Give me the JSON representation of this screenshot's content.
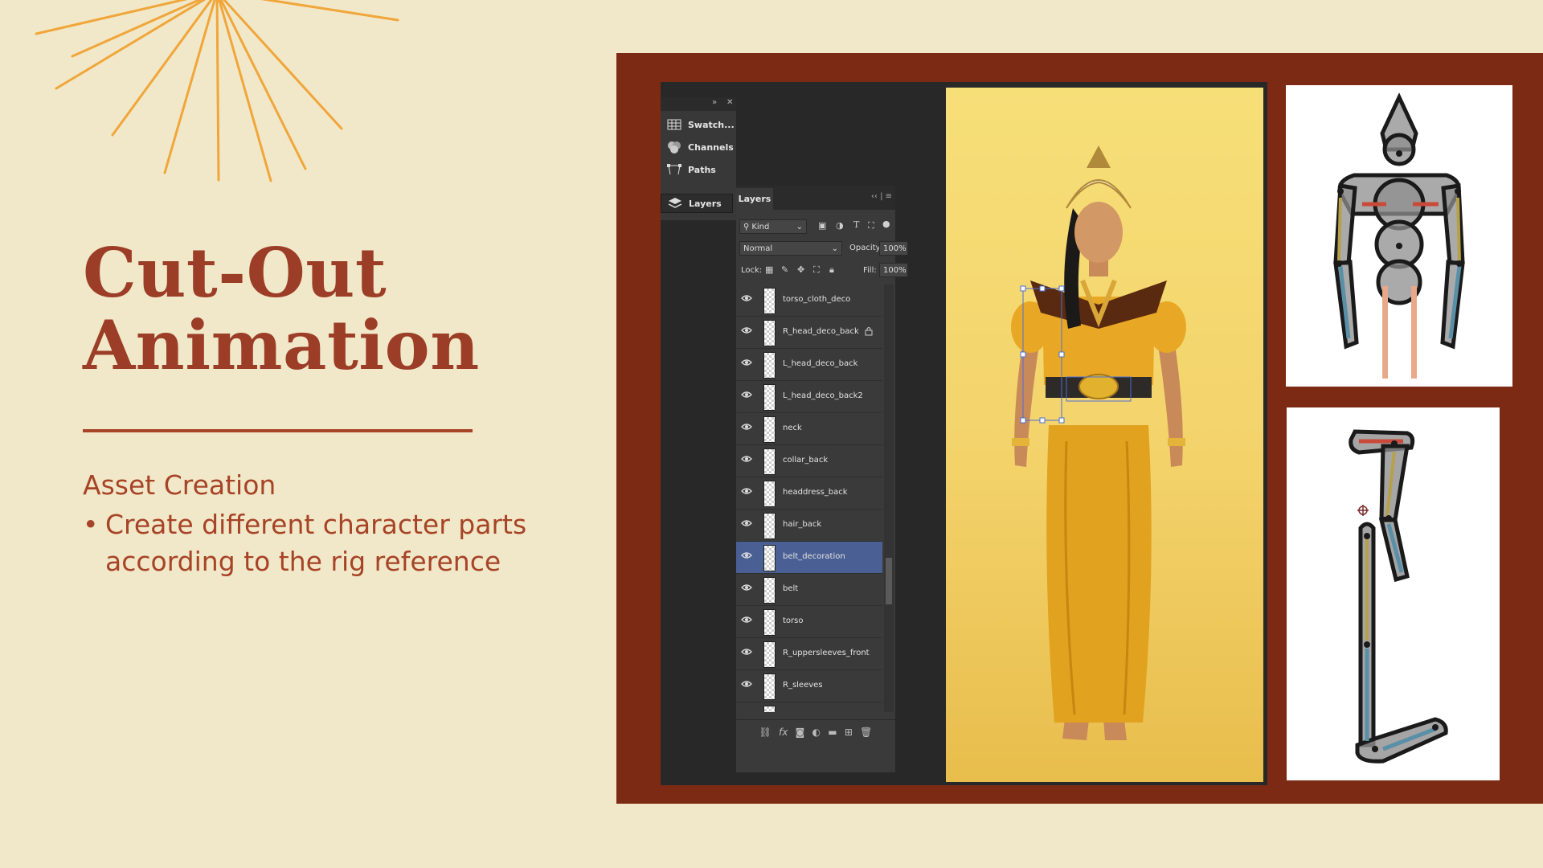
{
  "slide": {
    "title_line1": "Cut-Out",
    "title_line2": "Animation",
    "subtitle": "Asset Creation",
    "bullet": "Create different character parts according to the rig reference",
    "colors": {
      "background": "#f1e8c9",
      "accent": "#a74326",
      "frame": "#7d2a14",
      "sunburst": "#f0a63a"
    }
  },
  "photoshop": {
    "dock": {
      "items": [
        {
          "label": "Swatch...",
          "icon": "swatches-icon"
        },
        {
          "label": "Channels",
          "icon": "channels-icon"
        },
        {
          "label": "Paths",
          "icon": "paths-icon"
        },
        {
          "label": "Layers",
          "icon": "layers-icon"
        }
      ]
    },
    "layers_panel": {
      "tab": "Layers",
      "filter_kind": "Kind",
      "blend_mode": "Normal",
      "opacity_label": "Opacity:",
      "opacity_value": "100%",
      "lock_label": "Lock:",
      "fill_label": "Fill:",
      "fill_value": "100%",
      "layers": [
        {
          "name": "torso_cloth_deco",
          "selected": false,
          "locked": false
        },
        {
          "name": "R_head_deco_back",
          "selected": false,
          "locked": true
        },
        {
          "name": "L_head_deco_back",
          "selected": false,
          "locked": false
        },
        {
          "name": "L_head_deco_back2",
          "selected": false,
          "locked": false
        },
        {
          "name": "neck",
          "selected": false,
          "locked": false
        },
        {
          "name": "collar_back",
          "selected": false,
          "locked": false
        },
        {
          "name": "headdress_back",
          "selected": false,
          "locked": false
        },
        {
          "name": "hair_back",
          "selected": false,
          "locked": false
        },
        {
          "name": "belt_decoration",
          "selected": true,
          "locked": false
        },
        {
          "name": "belt",
          "selected": false,
          "locked": false
        },
        {
          "name": "torso",
          "selected": false,
          "locked": false
        },
        {
          "name": "R_uppersleeves_front",
          "selected": false,
          "locked": false
        },
        {
          "name": "R_sleeves",
          "selected": false,
          "locked": false
        },
        {
          "name": "",
          "selected": false,
          "locked": false
        }
      ],
      "footer_icons": [
        "link-icon",
        "fx-icon",
        "mask-icon",
        "adjustment-icon",
        "folder-icon",
        "new-layer-icon",
        "trash-icon"
      ]
    }
  }
}
